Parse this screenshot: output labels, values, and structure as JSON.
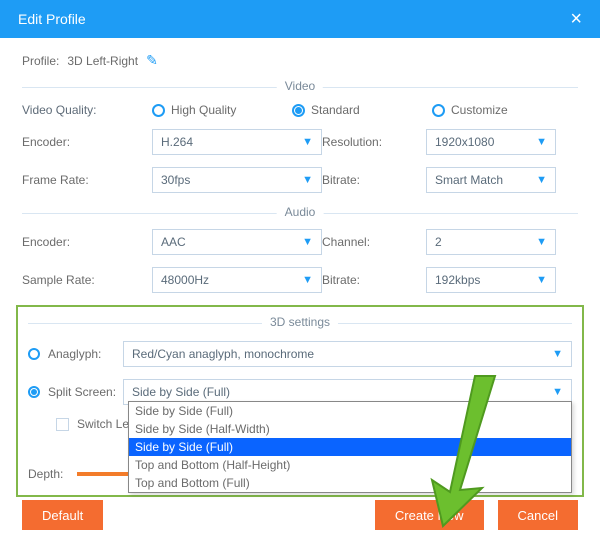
{
  "titlebar": {
    "title": "Edit Profile"
  },
  "profile": {
    "label": "Profile:",
    "value": "3D Left-Right"
  },
  "sections": {
    "video": "Video",
    "audio": "Audio",
    "three_d": "3D settings"
  },
  "video": {
    "quality_label": "Video Quality:",
    "quality_options": {
      "high": "High Quality",
      "standard": "Standard",
      "customize": "Customize"
    },
    "encoder_label": "Encoder:",
    "encoder_value": "H.264",
    "resolution_label": "Resolution:",
    "resolution_value": "1920x1080",
    "framerate_label": "Frame Rate:",
    "framerate_value": "30fps",
    "bitrate_label": "Bitrate:",
    "bitrate_value": "Smart Match"
  },
  "audio": {
    "encoder_label": "Encoder:",
    "encoder_value": "AAC",
    "channel_label": "Channel:",
    "channel_value": "2",
    "samplerate_label": "Sample Rate:",
    "samplerate_value": "48000Hz",
    "bitrate_label": "Bitrate:",
    "bitrate_value": "192kbps"
  },
  "three_d": {
    "anaglyph_label": "Anaglyph:",
    "anaglyph_value": "Red/Cyan anaglyph, monochrome",
    "split_label": "Split Screen:",
    "split_value": "Side by Side (Full)",
    "switch_label": "Switch Left",
    "depth_label": "Depth:",
    "dropdown": {
      "opt0": "Side by Side (Half-Width)",
      "opt1": "Side by Side (Full)",
      "opt2": "Top and Bottom (Half-Height)",
      "opt3": "Top and Bottom (Full)"
    }
  },
  "buttons": {
    "default": "Default",
    "create": "Create New",
    "cancel": "Cancel"
  },
  "colors": {
    "primary": "#1e9cf5",
    "accent": "#f46c30",
    "highlight_box": "#82b84a",
    "arrow": "#6cbf2e"
  }
}
